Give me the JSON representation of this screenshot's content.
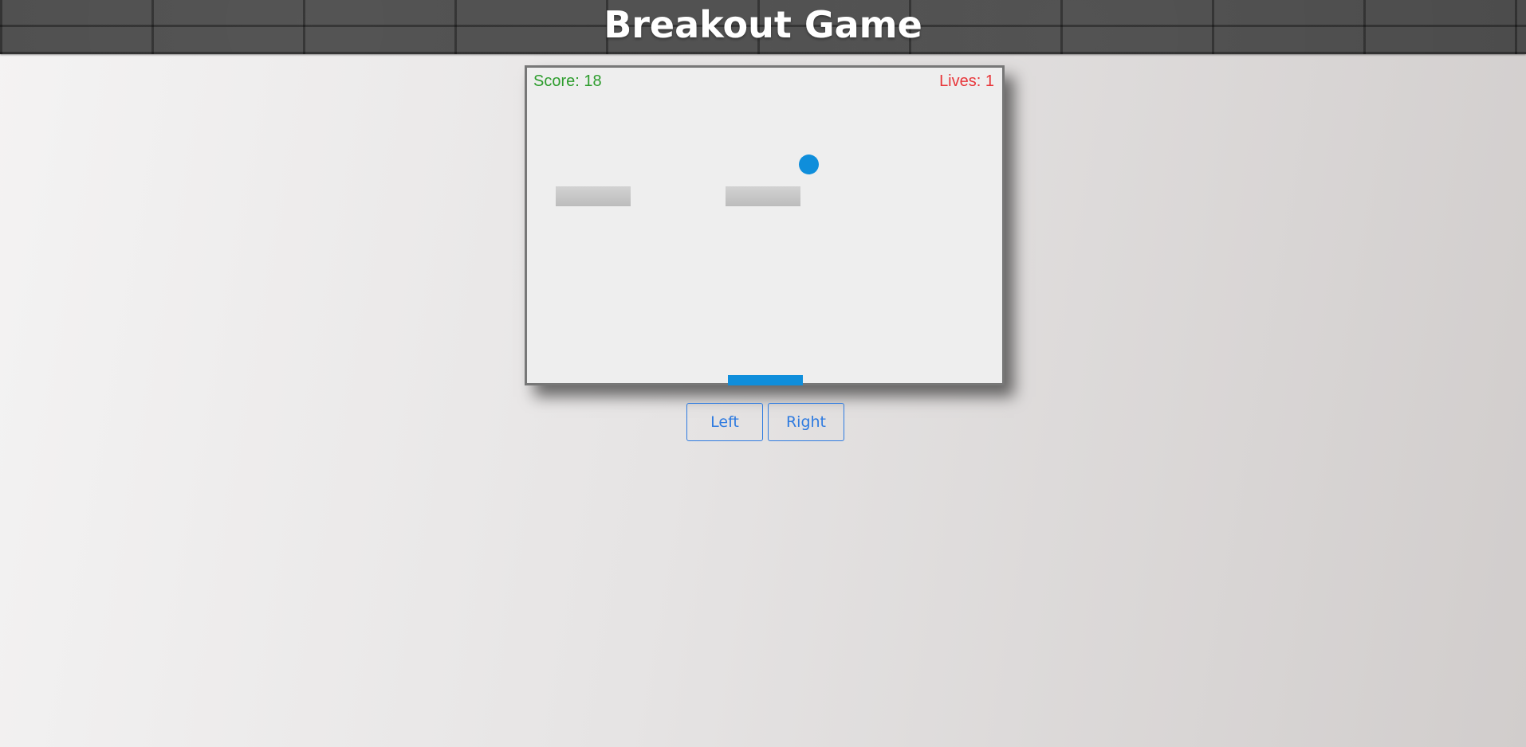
{
  "page": {
    "title": "Breakout Game"
  },
  "hud": {
    "score_text": "Score: 18",
    "lives_text": "Lives: 1",
    "score_color": "#2e9d2e",
    "lives_color": "#e8363a"
  },
  "game": {
    "score": 18,
    "lives": 1,
    "ball_color": "#0f8edb",
    "paddle_color": "#0f8edb",
    "brick_color": "#c8c8c8",
    "bricks_remaining": 2
  },
  "controls": {
    "left_label": "Left",
    "right_label": "Right",
    "button_color": "#2f7be0"
  }
}
